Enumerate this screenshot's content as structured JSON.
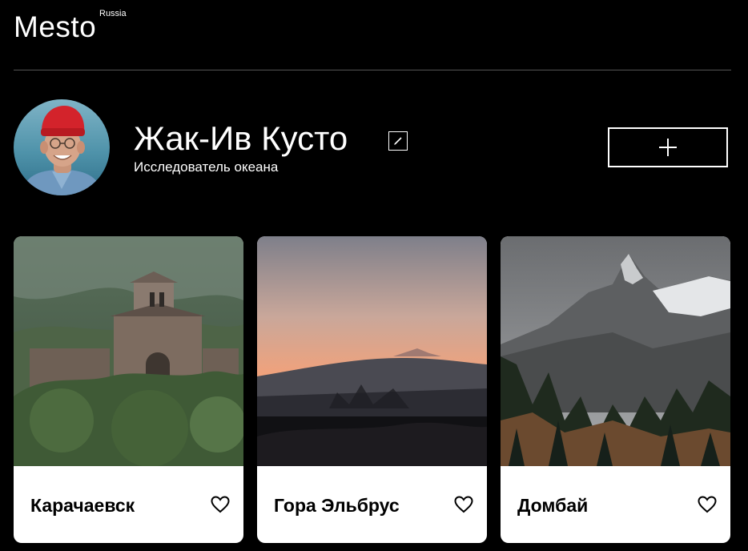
{
  "header": {
    "logo_text": "Mesto",
    "logo_superscript": "Russia"
  },
  "profile": {
    "name": "Жак-Ив Кусто",
    "about": "Исследователь океана",
    "avatar_icon": "avatar-photo",
    "edit_icon": "pencil-icon",
    "add_icon": "plus-icon"
  },
  "cards": [
    {
      "title": "Карачаевск",
      "image": "church-ruins-mountains",
      "like_icon": "heart-outline-icon"
    },
    {
      "title": "Гора Эльбрус",
      "image": "sunset-mountain-silhouette",
      "like_icon": "heart-outline-icon"
    },
    {
      "title": "Домбай",
      "image": "snowy-peaks-forest",
      "like_icon": "heart-outline-icon"
    }
  ],
  "colors": {
    "background": "#000000",
    "text": "#ffffff",
    "card_background": "#ffffff",
    "card_text": "#000000",
    "divider": "#545454"
  }
}
